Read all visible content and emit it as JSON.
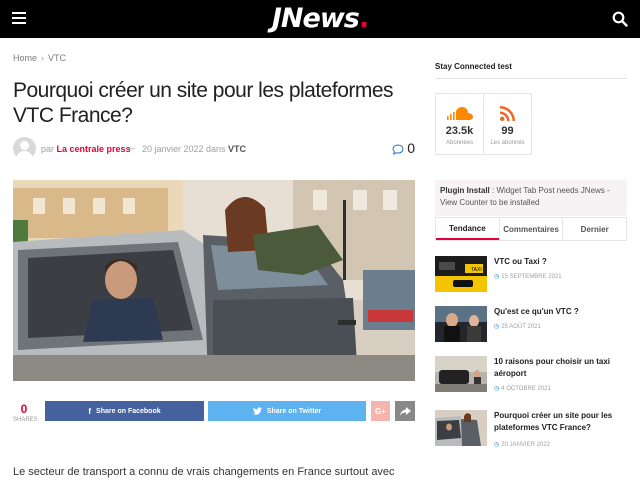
{
  "header": {
    "logo_text": "JNews",
    "logo_dot": ".",
    "menu_icon": "hamburger-icon",
    "search_icon": "search-icon",
    "accent_color": "#e4003a"
  },
  "breadcrumb": {
    "home": "Home",
    "separator": "›",
    "category": "VTC"
  },
  "article": {
    "title": "Pourquoi créer un site pour les plateformes VTC France?",
    "meta": {
      "by": "par",
      "author": "La centrale press",
      "dash": "—",
      "date": "20 janvier 2022",
      "in": "dans",
      "category": "VTC",
      "comment_count": "0"
    },
    "share": {
      "count": "0",
      "count_label": "SHARES",
      "facebook_label": "Share on Facebook",
      "twitter_label": "Share on Twitter",
      "googleplus_label": "G+",
      "facebook_color": "#45629f",
      "twitter_color": "#5eb2ef"
    },
    "excerpt": "Le secteur de transport a connu de vrais changements en France surtout avec"
  },
  "sidebar": {
    "widget_title": "Stay Connected test",
    "social": [
      {
        "icon": "soundcloud-icon",
        "count": "23.5k",
        "label": "Abonnées"
      },
      {
        "icon": "rss-icon",
        "count": "99",
        "label": "Les abonnés"
      }
    ],
    "plugin_notice": {
      "bold": "Plugin Install",
      "text": " : Widget Tab Post needs JNews - View Counter to be installed"
    },
    "tabs": [
      "Tendance",
      "Commentaires",
      "Dernier"
    ],
    "posts": [
      {
        "title": "VTC ou Taxi ?",
        "date": "15 SEPTEMBRE 2021"
      },
      {
        "title": "Qu'est ce qu'un VTC ?",
        "date": "25 AOÛT 2021"
      },
      {
        "title": "10 raisons pour choisir un taxi aéroport",
        "date": "4 OCTOBRE 2021"
      },
      {
        "title": "Pourquoi créer un site pour les plateformes VTC France?",
        "date": "20 JANVIER 2022"
      }
    ]
  }
}
